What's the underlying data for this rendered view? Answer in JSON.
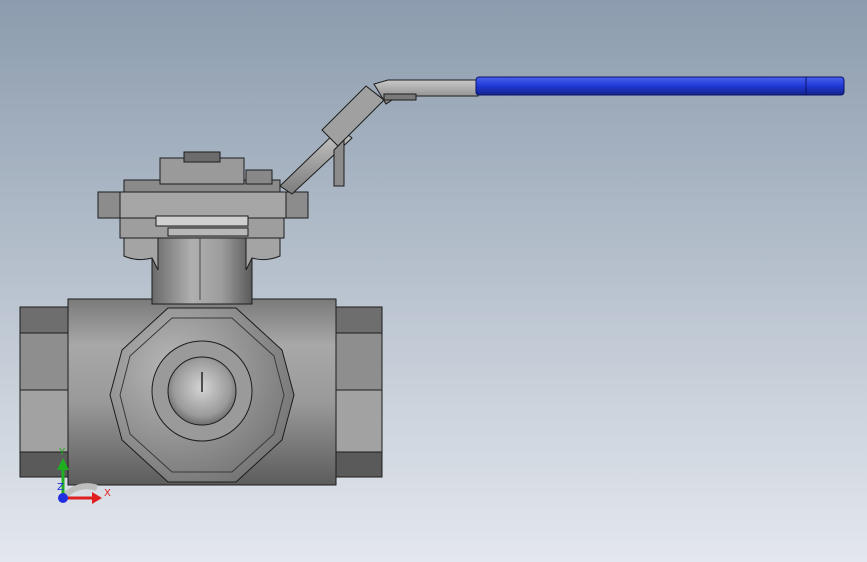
{
  "viewport": {
    "background_top": "#8c9cae",
    "background_bottom": "#e4e8ee"
  },
  "model": {
    "body_color": "#8a8a8a",
    "edge_color": "#1c1c1c",
    "handle_grip_color": "#1f38d6"
  },
  "triad": {
    "x_label": "X",
    "y_label": "Y",
    "z_label": "Z",
    "x_color": "#e02020",
    "y_color": "#1fb01f",
    "z_color": "#2030e0"
  }
}
